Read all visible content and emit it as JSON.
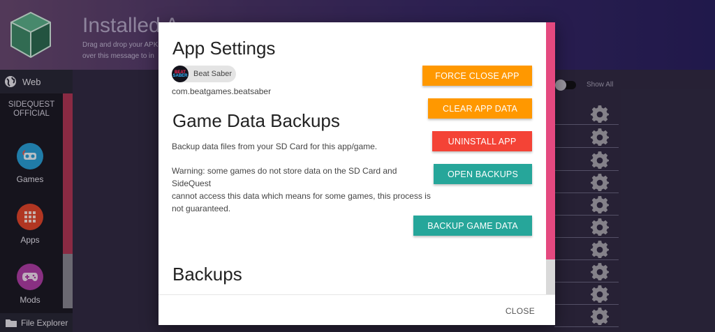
{
  "colors": {
    "orange": "#ff9800",
    "red": "#f44336",
    "teal": "#26a69a",
    "accent_pink": "#e4497f"
  },
  "header": {
    "title": "Installed A",
    "subtitle_line1": "Drag and drop your APK",
    "subtitle_line2": "over this message to in",
    "logo_icon": "sidequest-cube-logo"
  },
  "sidebar": {
    "web_label": "Web",
    "web_icon": "globe-icon",
    "official_line1": "SIDEQUEST",
    "official_line2": "OFFICIAL",
    "nav": [
      {
        "label": "Games",
        "icon": "vr-headset-icon",
        "color": "#2a9fd8"
      },
      {
        "label": "Apps",
        "icon": "grid-icon",
        "color": "#e3462c"
      },
      {
        "label": "Mods",
        "icon": "gamepad-icon",
        "color": "#b03ea7"
      }
    ],
    "file_explorer_label": "File Explorer",
    "file_explorer_icon": "folder-icon"
  },
  "list": {
    "show_all_label": "Show All",
    "row_icon": "gear-icon"
  },
  "modal": {
    "title": "App Settings",
    "app_name": "Beat Saber",
    "app_avatar_top": "BEAT",
    "app_avatar_bottom": "SABER",
    "package": "com.beatgames.beatsaber",
    "backups_section_title": "Game Data Backups",
    "backups_desc": "Backup data files from your SD Card for this app/game.",
    "warning_line1": "Warning: some games do not store data on the SD Card and",
    "warning_line2": "SideQuest",
    "warning_line3": "cannot access this data which means for some games, this process is",
    "warning_line4": "not guaranteed.",
    "backups_list_title": "Backups",
    "buttons": {
      "force_close": "FORCE CLOSE APP",
      "clear_data": "CLEAR APP DATA",
      "uninstall": "UNINSTALL APP",
      "open_backups": "OPEN BACKUPS",
      "backup_game_data": "BACKUP GAME DATA"
    },
    "close_label": "CLOSE"
  }
}
